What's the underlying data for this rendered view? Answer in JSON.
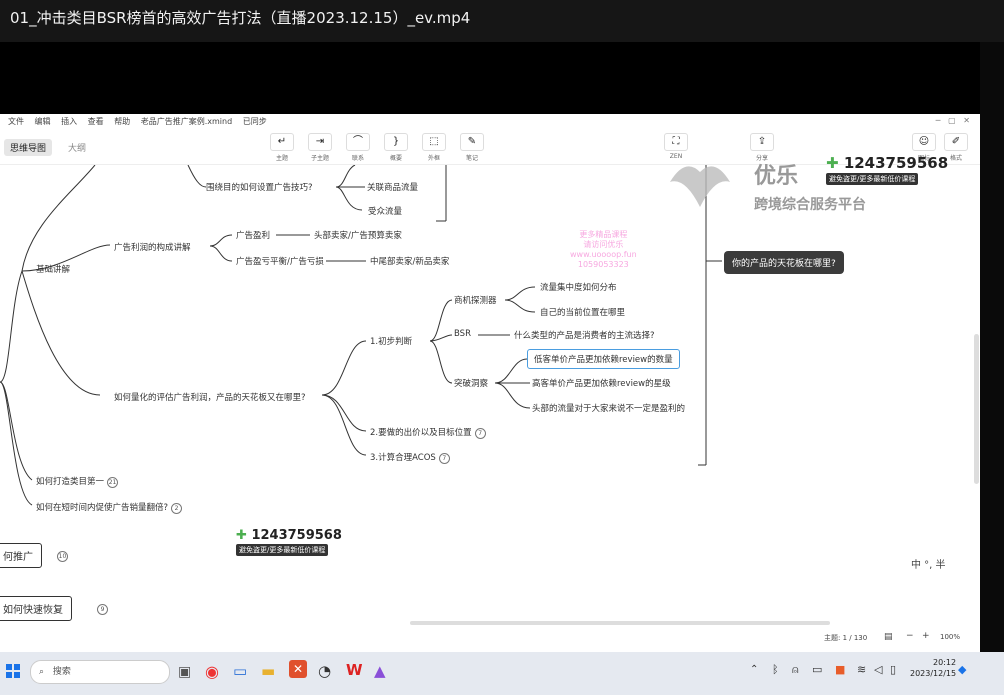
{
  "player": {
    "title": "01_冲击类目BSR榜首的高效广告打法（直播2023.12.15）_ev.mp4"
  },
  "menubar": {
    "items": [
      "文件",
      "编辑",
      "插入",
      "查看",
      "帮助",
      "老品广告推广案例.xmind",
      "已同步"
    ]
  },
  "toolbar": {
    "tabs": [
      {
        "label": "思维导图"
      },
      {
        "label": "大纲"
      }
    ],
    "buttons": [
      {
        "icon": "topic",
        "label": "主题"
      },
      {
        "icon": "subtopic",
        "label": "子主题"
      },
      {
        "icon": "relationship",
        "label": "联系"
      },
      {
        "icon": "summary",
        "label": "概要"
      },
      {
        "icon": "boundary",
        "label": "外框"
      },
      {
        "icon": "note",
        "label": "笔记"
      },
      {
        "icon": "zen",
        "label": "ZEN"
      },
      {
        "icon": "share",
        "label": "分享"
      },
      {
        "icon": "outline",
        "label": "图标"
      },
      {
        "icon": "format",
        "label": "格式"
      }
    ]
  },
  "mindmap": {
    "top": {
      "partial": "团",
      "bottom": "围绕目的如何设置广告技巧?",
      "branch1": "关联商品流量",
      "branch2": "受众流量"
    },
    "jichu": "基础讲解",
    "lirun": "广告利润的构成讲解",
    "yingli": "广告盈利",
    "yingli_child": "头部卖家/广告预算卖家",
    "yingkui": "广告盈亏平衡/广告亏损",
    "yingkui_child": "中尾部卖家/新品卖家",
    "lianghua": "如何量化的评估广告利润，产品的天花板又在哪里?",
    "chubu": "1.初步判断",
    "shangji": "商机探测器",
    "liuliang": "流量集中度如何分布",
    "weizhi": "自己的当前位置在哪里",
    "bsr": "BSR",
    "bsr_child": "什么类型的产品是消费者的主流选择?",
    "tupo": "突破洞察",
    "tupo1": "低客单价产品更加依赖review的数量",
    "tupo2": "高客单价产品更加依赖review的星级",
    "tupo3": "头部的流量对于大家来说不一定是盈利的",
    "chujia": "2.要做的出价以及目标位置",
    "chujia_badge": "7",
    "acos": "3.计算合理ACOS",
    "acos_badge": "7",
    "tianhua": "你的产品的天花板在哪里?",
    "leimu": "如何打造类目第一",
    "leimu_badge": "21",
    "xiaoliang": "如何在短时间内促使广告销量翻倍?",
    "xiaoliang_badge": "2",
    "tuiguang": "何推广",
    "tuiguang_badge": "10",
    "huifu": "如何快速恢复",
    "huifu_badge": "9"
  },
  "watermark": {
    "phone": "1243759568",
    "sub": "避免盗更/更多最新低价课程",
    "brand": "优乐",
    "brand_sub": "跨境综合服务平台",
    "pink_lines": [
      "更多精品课程",
      "请访问优乐",
      "www.uoooop.fun",
      "1059053323"
    ]
  },
  "statusbar": {
    "topics": "主题: 1 / 130",
    "zoom": "100%"
  },
  "ime": {
    "text": "中 °, 半"
  },
  "taskbar": {
    "search_placeholder": "搜索",
    "time": "20:12",
    "date": "2023/12/15"
  }
}
